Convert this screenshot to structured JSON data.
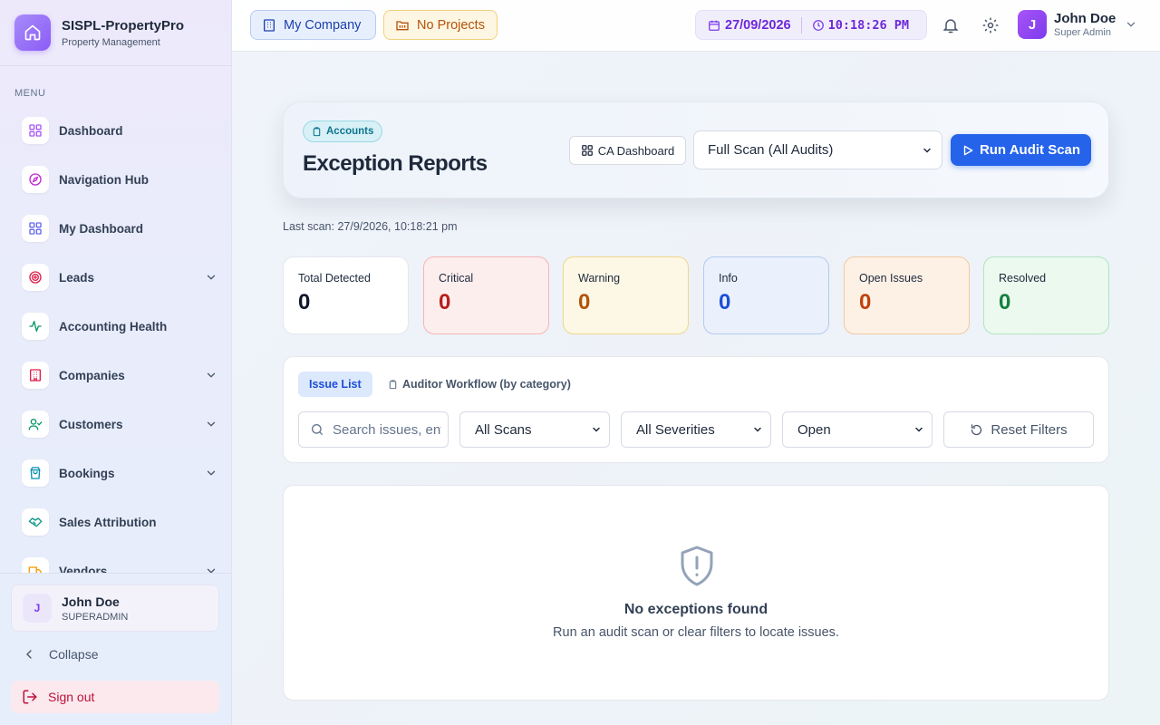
{
  "brand": {
    "title": "SISPL-PropertyPro",
    "subtitle": "Property Management"
  },
  "sidebar": {
    "menu_label": "MENU",
    "items": [
      {
        "label": "Dashboard",
        "icon": "grid-icon",
        "color": "#a855f7",
        "has_children": false
      },
      {
        "label": "Navigation Hub",
        "icon": "compass-icon",
        "color": "#a855f7",
        "has_children": false
      },
      {
        "label": "My Dashboard",
        "icon": "grid-icon",
        "color": "#6366f1",
        "has_children": false
      },
      {
        "label": "Leads",
        "icon": "target-icon",
        "color": "#e11d48",
        "has_children": true
      },
      {
        "label": "Accounting Health",
        "icon": "activity-icon",
        "color": "#059669",
        "has_children": false
      },
      {
        "label": "Companies",
        "icon": "building-icon",
        "color": "#e11d48",
        "has_children": true
      },
      {
        "label": "Customers",
        "icon": "user-check-icon",
        "color": "#059669",
        "has_children": true
      },
      {
        "label": "Bookings",
        "icon": "shopping-bag-icon",
        "color": "#0891b2",
        "has_children": true
      },
      {
        "label": "Sales Attribution",
        "icon": "handshake-icon",
        "color": "#0d9488",
        "has_children": false
      },
      {
        "label": "Vendors",
        "icon": "truck-icon",
        "color": "#f59e0b",
        "has_children": true
      }
    ],
    "user": {
      "initial": "J",
      "name": "John Doe",
      "role": "SUPERADMIN"
    },
    "collapse_label": "Collapse",
    "signout_label": "Sign out"
  },
  "topbar": {
    "company_label": "My Company",
    "projects_label": "No Projects",
    "date": "27/09/2026",
    "time": "10:18:26 PM",
    "user": {
      "initial": "J",
      "name": "John Doe",
      "role": "Super Admin"
    }
  },
  "header": {
    "badge": "Accounts",
    "title": "Exception Reports",
    "ca_dashboard_label": "CA Dashboard",
    "scan_select_value": "Full Scan (All Audits)",
    "run_button_label": "Run Audit Scan"
  },
  "last_scan": "Last scan: 27/9/2026, 10:18:21 pm",
  "stats": [
    {
      "label": "Total Detected",
      "value": "0",
      "bg": "#ffffff",
      "border": "#e5e7eb",
      "color": "#0f172a"
    },
    {
      "label": "Critical",
      "value": "0",
      "bg": "#fdeeee",
      "border": "#f5b5b5",
      "color": "#b91c1c"
    },
    {
      "label": "Warning",
      "value": "0",
      "bg": "#fdf8e6",
      "border": "#f1d58a",
      "color": "#b45309"
    },
    {
      "label": "Info",
      "value": "0",
      "bg": "#eaf1fc",
      "border": "#b4c9ef",
      "color": "#1d4ed8"
    },
    {
      "label": "Open Issues",
      "value": "0",
      "bg": "#fdf1e6",
      "border": "#f3c9a1",
      "color": "#c2410c"
    },
    {
      "label": "Resolved",
      "value": "0",
      "bg": "#ecf9ef",
      "border": "#b2e4c0",
      "color": "#15803d"
    }
  ],
  "filters": {
    "tab_issue": "Issue List",
    "tab_workflow": "Auditor Workflow (by category)",
    "search_placeholder": "Search issues, entities...",
    "scan_filter": "All Scans",
    "severity_filter": "All Severities",
    "status_filter": "Open",
    "reset_label": "Reset Filters"
  },
  "empty": {
    "title": "No exceptions found",
    "subtitle": "Run an audit scan or clear filters to locate issues."
  }
}
